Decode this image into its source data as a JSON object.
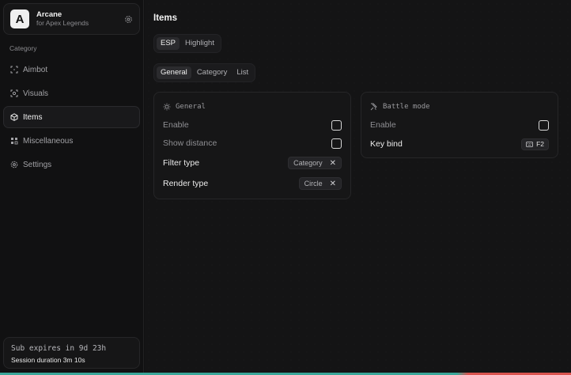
{
  "app": {
    "name": "Arcane",
    "subtitle": "for Apex Legends",
    "logo_letter": "A"
  },
  "sidebar": {
    "section_label": "Category",
    "items": [
      {
        "label": "Aimbot",
        "icon": "crosshair-icon"
      },
      {
        "label": "Visuals",
        "icon": "eye-icon"
      },
      {
        "label": "Items",
        "icon": "box-icon",
        "active": true
      },
      {
        "label": "Miscellaneous",
        "icon": "grid-icon"
      },
      {
        "label": "Settings",
        "icon": "gear-icon"
      }
    ],
    "footer": {
      "expires": "Sub expires in 9d 23h",
      "session_label": "Session duration",
      "session_value": "3m 10s"
    }
  },
  "main": {
    "title": "Items",
    "top_tabs": [
      {
        "label": "ESP",
        "active": true
      },
      {
        "label": "Highlight"
      }
    ],
    "sub_tabs": [
      {
        "label": "General",
        "active": true
      },
      {
        "label": "Category"
      },
      {
        "label": "List"
      }
    ],
    "general_card": {
      "title": "General",
      "enable_label": "Enable",
      "show_distance_label": "Show distance",
      "filter_type_label": "Filter type",
      "filter_type_value": "Category",
      "render_type_label": "Render type",
      "render_type_value": "Circle",
      "clear_glyph": "✕"
    },
    "battle_card": {
      "title": "Battle mode",
      "enable_label": "Enable",
      "keybind_label": "Key bind",
      "keybind_value": "F2"
    }
  },
  "colors": {
    "background": "#111112",
    "panel": "#161617",
    "accent_strip": "#3aa79a",
    "strip_end": "#d9534f"
  }
}
